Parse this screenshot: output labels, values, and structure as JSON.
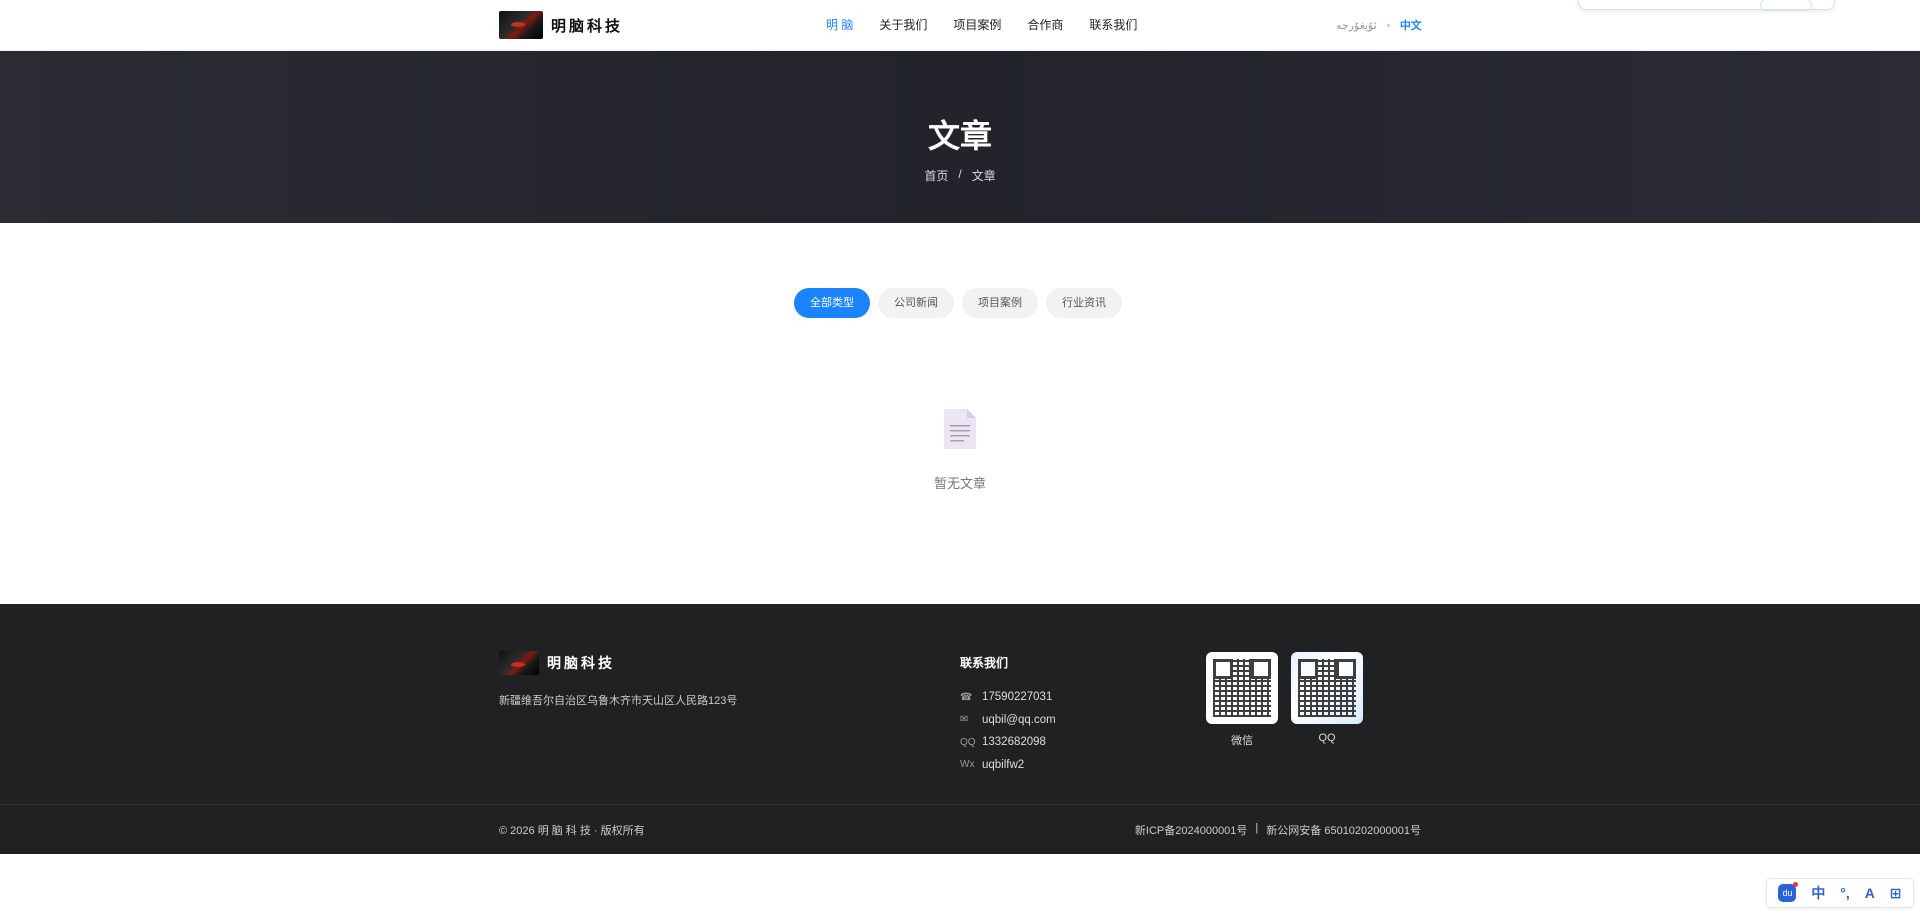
{
  "header": {
    "brand": "明脑科技",
    "nav": [
      {
        "label": "明 脑",
        "active": true
      },
      {
        "label": "关于我们",
        "active": false
      },
      {
        "label": "项目案例",
        "active": false
      },
      {
        "label": "合作商",
        "active": false
      },
      {
        "label": "联系我们",
        "active": false
      }
    ],
    "lang_ug": "ئۇيغۇرچە",
    "lang_zh": "中文"
  },
  "banner": {
    "title": "文章",
    "breadcrumb_home": "首页",
    "breadcrumb_sep": "/",
    "breadcrumb_current": "文章"
  },
  "filters": [
    {
      "label": "全部类型",
      "active": true
    },
    {
      "label": "公司新闻",
      "active": false
    },
    {
      "label": "项目案例",
      "active": false
    },
    {
      "label": "行业资讯",
      "active": false
    }
  ],
  "empty": {
    "icon": "document-icon",
    "text": "暂无文章"
  },
  "footer": {
    "brand": "明脑科技",
    "address": "新疆维吾尔自治区乌鲁木齐市天山区人民路123号",
    "contact_title": "联系我们",
    "contacts": [
      {
        "icon": "☎",
        "value": "17590227031"
      },
      {
        "icon": "✉",
        "value": "uqbil@qq.com"
      },
      {
        "icon": "QQ",
        "value": "1332682098"
      },
      {
        "icon": "Wx",
        "value": "uqbilfw2"
      }
    ],
    "qr_wechat_label": "微信",
    "qr_qq_label": "QQ",
    "copyright": "© 2026 明 脑 科 技 · 版权所有",
    "icp": "新ICP备2024000001号",
    "icp_sep": "|",
    "police": "新公网安备 65010202000001号"
  },
  "ime": {
    "du": "du",
    "zh": "中",
    "punct": "°,",
    "skin": "A",
    "grid": "⊞"
  },
  "colors": {
    "accent": "#1a84ff",
    "banner_bg": "#25262e",
    "footer_bg": "#202123"
  }
}
